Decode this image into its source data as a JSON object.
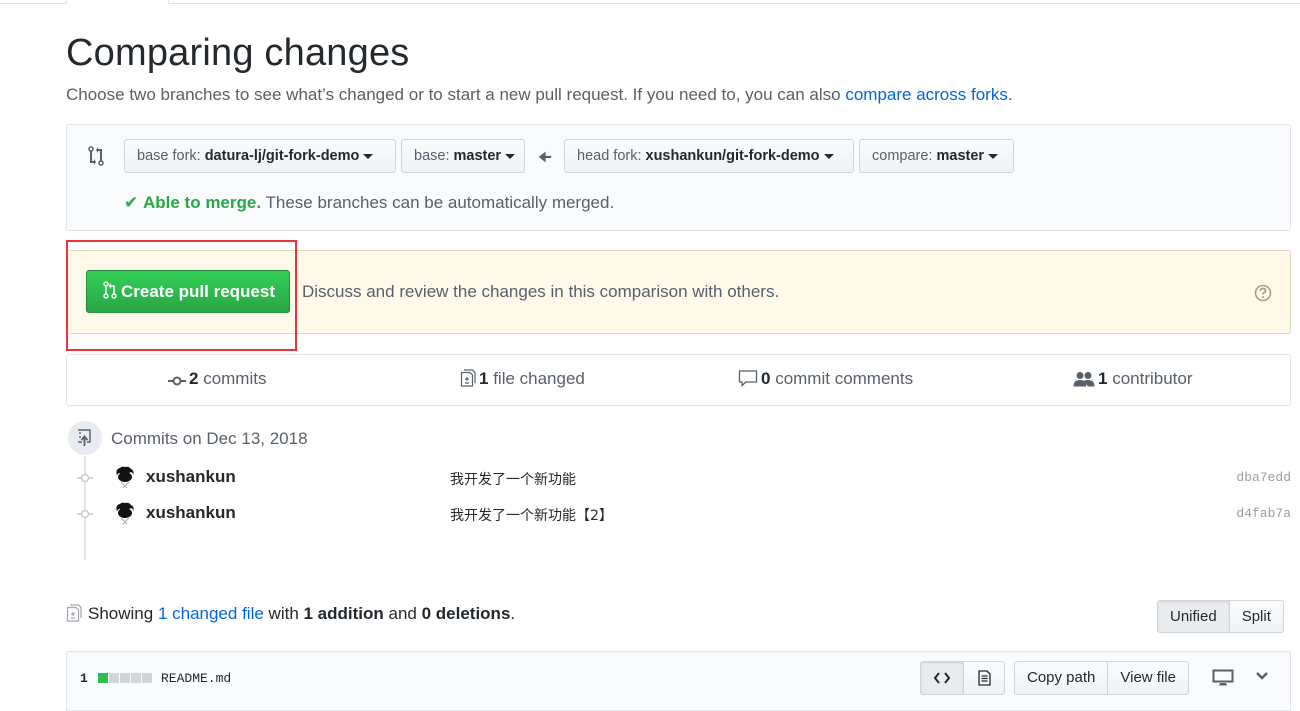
{
  "header": {
    "title": "Comparing changes",
    "subtitle": "Choose two branches to see what’s changed or to start a new pull request. If you need to, you can also ",
    "subtitle_link": "compare across forks."
  },
  "range": {
    "base_fork_label": "base fork: ",
    "base_fork_value": "datura-lj/git-fork-demo",
    "base_label": "base: ",
    "base_value": "master",
    "head_fork_label": "head fork: ",
    "head_fork_value": "xushankun/git-fork-demo",
    "compare_label": "compare: ",
    "compare_value": "master",
    "merge_ok": "Able to merge.",
    "merge_text": " These branches can be automatically merged."
  },
  "pull_request": {
    "button_label": "Create pull request",
    "description": "Discuss and review the changes in this comparison with others."
  },
  "summary": {
    "commits_count": "2",
    "commits_label": " commits",
    "files_count": "1",
    "files_label": " file changed",
    "comments_count": "0",
    "comments_label": " commit comments",
    "contributors_count": "1",
    "contributors_label": " contributor"
  },
  "commits": {
    "group_title": "Commits on Dec 13, 2018",
    "items": [
      {
        "author": "xushankun",
        "message": "我开发了一个新功能",
        "sha": "dba7edd"
      },
      {
        "author": "xushankun",
        "message": "我开发了一个新功能【2】",
        "sha": "d4fab7a"
      }
    ]
  },
  "files": {
    "showing": "Showing ",
    "changed_link": "1 changed file",
    "with": " with ",
    "additions": "1 addition",
    "and": " and ",
    "deletions": "0 deletions",
    "period": ".",
    "view_unified": "Unified",
    "view_split": "Split",
    "file": {
      "diffstat": "1",
      "name": "README.md",
      "copy_path": "Copy path",
      "view_file": "View file"
    }
  },
  "colors": {
    "accent_link": "#0366d6",
    "success": "#28a745",
    "highlight_box": "#e8353a"
  }
}
